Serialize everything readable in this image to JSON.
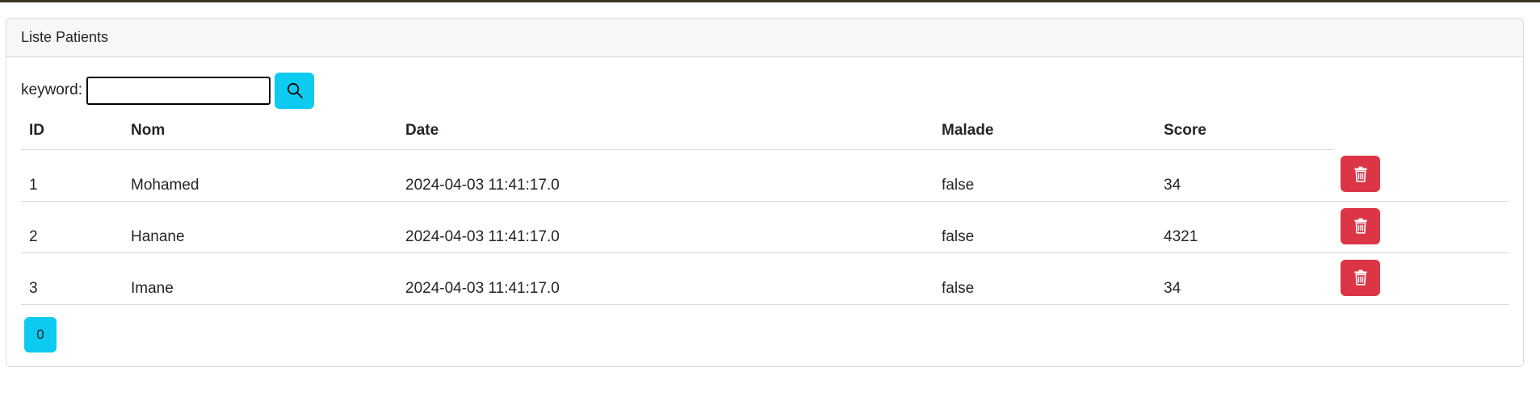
{
  "card": {
    "title": "Liste Patients"
  },
  "search": {
    "label": "keyword:",
    "value": "",
    "placeholder": ""
  },
  "table": {
    "headers": [
      "ID",
      "Nom",
      "Date",
      "Malade",
      "Score"
    ],
    "rows": [
      {
        "id": "1",
        "nom": "Mohamed",
        "date": "2024-04-03 11:41:17.0",
        "malade": "false",
        "score": "34"
      },
      {
        "id": "2",
        "nom": "Hanane",
        "date": "2024-04-03 11:41:17.0",
        "malade": "false",
        "score": "4321"
      },
      {
        "id": "3",
        "nom": "Imane",
        "date": "2024-04-03 11:41:17.0",
        "malade": "false",
        "score": "34"
      }
    ]
  },
  "pagination": {
    "pages": [
      "0"
    ]
  },
  "colors": {
    "info": "#0dcaf0",
    "danger": "#dc3545"
  },
  "icons": {
    "search": "search-icon",
    "delete": "trash-icon"
  }
}
